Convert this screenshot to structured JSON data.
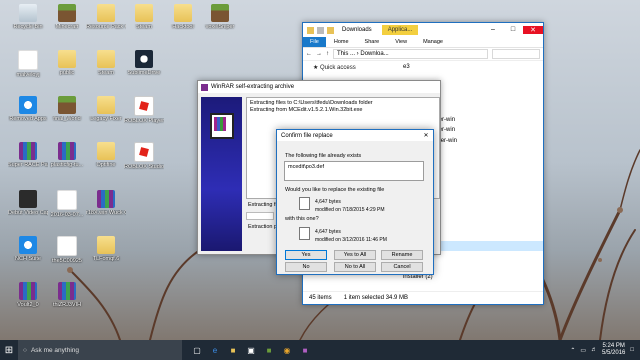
{
  "desktop": {
    "icons": [
      {
        "label": "Recycle Bin",
        "kind": "recycle"
      },
      {
        "label": "Minecraft",
        "kind": "mc"
      },
      {
        "label": "Resource Pack Creator",
        "kind": "folder"
      },
      {
        "label": "Steam",
        "kind": "folder"
      },
      {
        "label": "Hacktool",
        "kind": "folder"
      },
      {
        "label": "voxelSniper",
        "kind": "mc"
      },
      {
        "label": "malveloyj",
        "kind": "doc"
      },
      {
        "label": "public",
        "kind": "folder"
      },
      {
        "label": "Steam",
        "kind": "folder"
      },
      {
        "label": "SublimeDrive",
        "kind": "steam"
      },
      {
        "label": "Removed Apps",
        "kind": "ie"
      },
      {
        "label": "final_World",
        "kind": "mc"
      },
      {
        "label": "Legacy Fixer",
        "kind": "folder"
      },
      {
        "label": "ROBLOX Player",
        "kind": "roblox"
      },
      {
        "label": "Super RACE Parkour",
        "kind": "winrar"
      },
      {
        "label": "plasticfig-tu...",
        "kind": "winrar"
      },
      {
        "label": "Optifine",
        "kind": "folder"
      },
      {
        "label": "ROBLOX Studio",
        "kind": "roblox"
      },
      {
        "label": "Debut Video Capture S...",
        "kind": "dark"
      },
      {
        "label": "2016-03-07...",
        "kind": "doc"
      },
      {
        "label": "r18X.win Wuck Client",
        "kind": "winrar"
      },
      {
        "label": "NCH Suite",
        "kind": "ie"
      },
      {
        "label": "the5C00925",
        "kind": "doc"
      },
      {
        "label": "TLFomqf.6",
        "kind": "folder"
      },
      {
        "label": "Voult2_0",
        "kind": "winrar"
      },
      {
        "label": "thiZRJ3VIH",
        "kind": "winrar"
      }
    ]
  },
  "explorer": {
    "title": "Downloads",
    "context_tab": "Applica...",
    "tabs": [
      "File",
      "Home",
      "Share",
      "View",
      "Manage"
    ],
    "address": "Downloa...",
    "address_prefix": "This ...",
    "nav": [
      "Quick access"
    ],
    "files": [
      "e3",
      "",
      "",
      "",
      "2",
      "2.1291-installer-win",
      "2.1291-installer-win",
      "885-1.9-installer-win",
      "",
      "",
      "",
      "",
      "",
      "586",
      "586",
      "586",
      "5.32bit",
      "5.32bit",
      "5.32bit",
      "nstaller",
      "installer (2)"
    ],
    "status_items": "45 items",
    "status_selected": "1 item selected  34.9 MB"
  },
  "winrar": {
    "title": "WinRAR self-extracting archive",
    "log_line1": "Extracting files to C:\\Users\\tfedu\\Downloads folder",
    "log_line2": "Extracting from MCEdit.v1.5.2.1.Win.32bit.exe",
    "extracting1": "Extracting fr",
    "extracting2": "Extraction p"
  },
  "confirm": {
    "title": "Confirm file replace",
    "exists_text": "The following file already exists",
    "filename": "mcedit\\po3.def",
    "question": "Would you like to replace the existing file",
    "existing_size": "4,647 bytes",
    "existing_modified": "modified on 7/18/2015 4:29 PM",
    "with_text": "with this one?",
    "new_size": "4,647 bytes",
    "new_modified": "modified on 3/12/2016 11:46 PM",
    "buttons": {
      "yes": "Yes",
      "yes_all": "Yes to All",
      "rename": "Rename",
      "no": "No",
      "no_all": "No to All",
      "cancel": "Cancel"
    }
  },
  "taskbar": {
    "search_placeholder": "Ask me anything",
    "time": "5:24 PM",
    "date": "5/5/2016"
  }
}
